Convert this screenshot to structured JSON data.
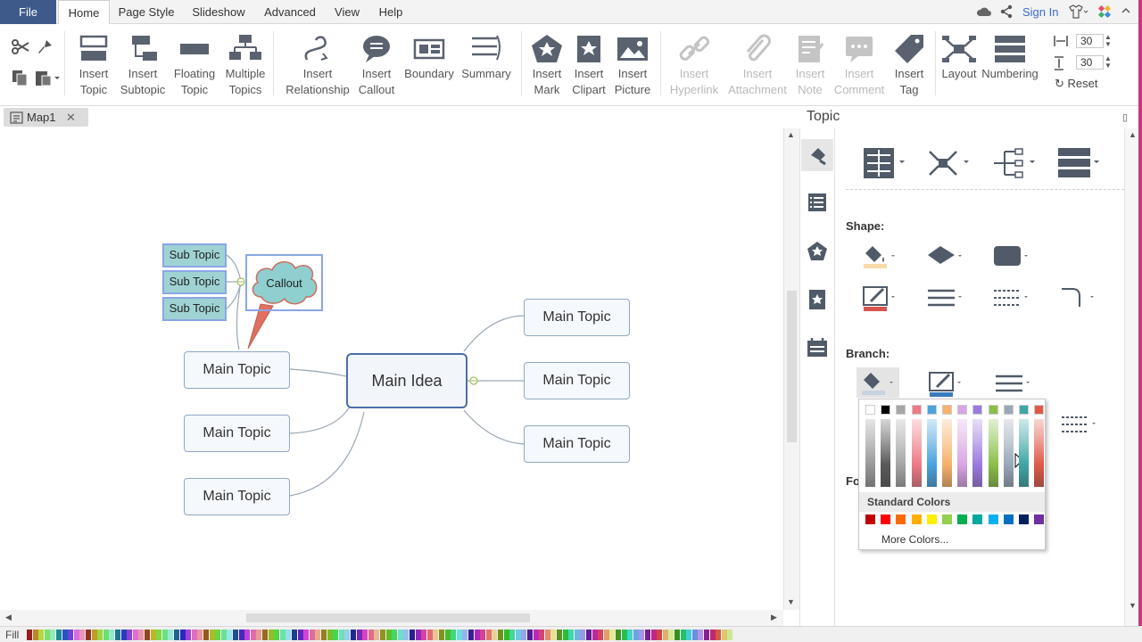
{
  "menubar": {
    "file": "File",
    "tabs": [
      "Home",
      "Page Style",
      "Slideshow",
      "Advanced",
      "View",
      "Help"
    ],
    "sign_in": "Sign In"
  },
  "ribbon": {
    "insert_topic": [
      "Insert",
      "Topic"
    ],
    "insert_subtopic": [
      "Insert",
      "Subtopic"
    ],
    "floating_topic": [
      "Floating",
      "Topic"
    ],
    "multiple_topics": [
      "Multiple",
      "Topics"
    ],
    "insert_relationship": [
      "Insert",
      "Relationship"
    ],
    "insert_callout": [
      "Insert",
      "Callout"
    ],
    "boundary": "Boundary",
    "summary": "Summary",
    "insert_mark": [
      "Insert",
      "Mark"
    ],
    "insert_clipart": [
      "Insert",
      "Clipart"
    ],
    "insert_picture": [
      "Insert",
      "Picture"
    ],
    "insert_hyperlink": [
      "Insert",
      "Hyperlink"
    ],
    "insert_attachment": [
      "Insert",
      "Attachment"
    ],
    "insert_note": [
      "Insert",
      "Note"
    ],
    "insert_comment": [
      "Insert",
      "Comment"
    ],
    "insert_tag": [
      "Insert",
      "Tag"
    ],
    "layout": "Layout",
    "numbering": "Numbering",
    "spacing_h": "30",
    "spacing_v": "30",
    "reset": "Reset"
  },
  "document": {
    "tab_name": "Map1"
  },
  "canvas": {
    "main_idea": "Main Idea",
    "left_topics": [
      "Main Topic",
      "Main Topic",
      "Main Topic"
    ],
    "right_topics": [
      "Main Topic",
      "Main Topic",
      "Main Topic"
    ],
    "subtopics": [
      "Sub Topic",
      "Sub Topic",
      "Sub Topic"
    ],
    "callout": "Callout"
  },
  "panel": {
    "title": "Topic",
    "shape_label": "Shape:",
    "branch_label": "Branch:",
    "font_label_partial": "Fo"
  },
  "color_picker": {
    "standard_colors_label": "Standard Colors",
    "more_colors": "More Colors...",
    "top_row": [
      "#ffffff",
      "#000000",
      "#a6a6a6",
      "#ee7a86",
      "#4aa3df",
      "#f6b26b",
      "#d9a6e3",
      "#9b7be0",
      "#8bbf4a",
      "#9aa8b8",
      "#3fa6a6",
      "#e05a4a"
    ],
    "standard": [
      "#c00000",
      "#ff0000",
      "#ff6a00",
      "#ffb000",
      "#ffef00",
      "#92d050",
      "#00b050",
      "#00a99d",
      "#00b0f0",
      "#0070c0",
      "#002060",
      "#7030a0"
    ]
  },
  "fillbar": {
    "label": "Fill"
  },
  "colors": {
    "file_tab": "#3d5a8a",
    "node_border": "#8fa8c8",
    "main_idea_border": "#4a6ea9",
    "subtopic_fill": "#9fd3d3",
    "callout_fill": "#8fcfd0"
  }
}
